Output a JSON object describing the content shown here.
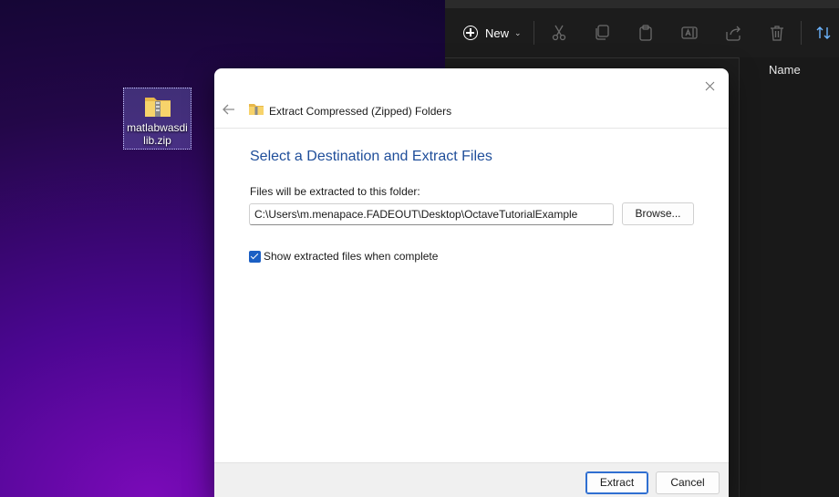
{
  "desktop": {
    "icon_label": "matlabwasdilib.zip",
    "icon_name": "zip-folder-icon"
  },
  "explorer": {
    "new_label": "New",
    "column_header": "Name",
    "toolbar_icons": [
      "cut-icon",
      "copy-icon",
      "paste-icon",
      "rename-icon",
      "share-icon",
      "delete-icon",
      "sort-icon"
    ]
  },
  "dialog": {
    "title": "Extract Compressed (Zipped) Folders",
    "heading": "Select a Destination and Extract Files",
    "files_label": "Files will be extracted to this folder:",
    "path_value": "C:\\Users\\m.menapace.FADEOUT\\Desktop\\OctaveTutorialExample",
    "browse_label": "Browse...",
    "checkbox_label": "Show extracted files when complete",
    "checkbox_checked": true,
    "extract_label": "Extract",
    "cancel_label": "Cancel"
  },
  "colors": {
    "accent": "#1b5fc4",
    "heading": "#1f4e9a",
    "explorer_bg": "#1c1c1c"
  }
}
